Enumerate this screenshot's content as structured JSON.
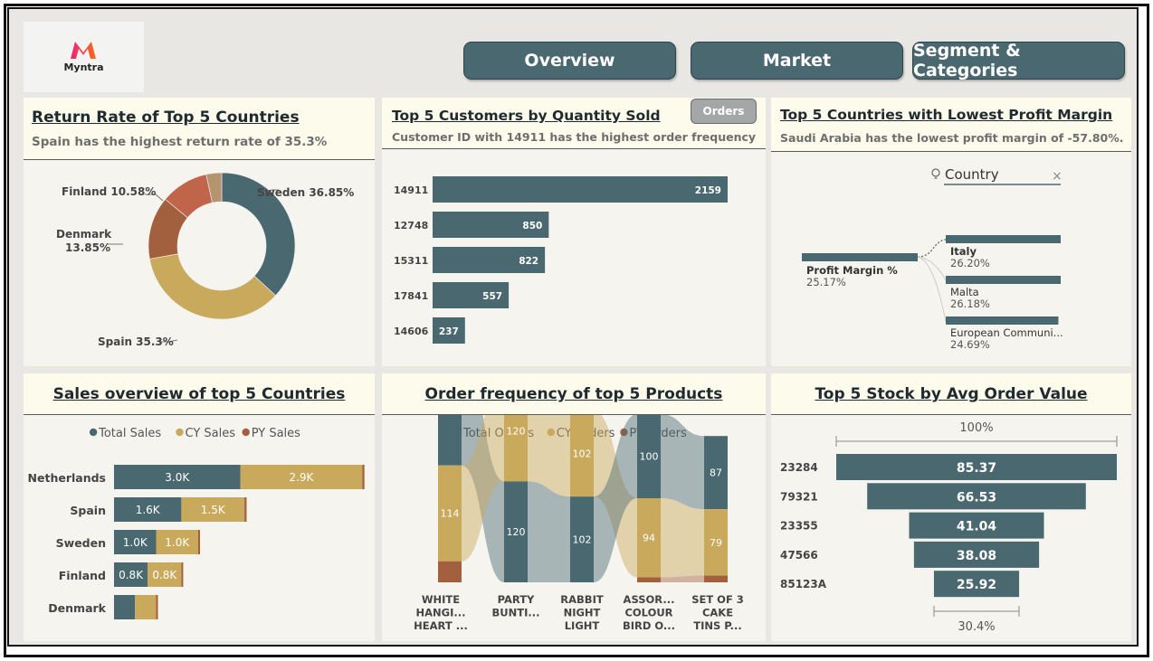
{
  "brand": {
    "name": "Myntra"
  },
  "nav": {
    "overview": "Overview",
    "market": "Market",
    "segment": "Segment & Categories"
  },
  "colors": {
    "slate": "#4a6870",
    "gold": "#c9a95c",
    "rust": "#a3603e",
    "tan": "#b59470",
    "red": "#c0644a",
    "panel": "#f6f4ef",
    "header": "#fdfbec"
  },
  "return_rate": {
    "title": "Return Rate of Top 5 Countries",
    "subtitle": "Spain has the highest return rate  of 35.3%",
    "labels": {
      "sweden": "Sweden 36.85%",
      "spain": "Spain 35.3%",
      "denmark_name": "Denmark",
      "denmark_pct": "13.85%",
      "finland": "Finland 10.58%"
    }
  },
  "customers": {
    "title": "Top 5 Customers by Quantity Sold",
    "subtitle": "Customer ID with 14911 has the highest order frequency",
    "orders_button": "Orders"
  },
  "profit_margin": {
    "title": "Top 5 Countries with Lowest Profit Margin",
    "subtitle": "Saudi Arabia has the lowest profit margin of -57.80%.",
    "search_label": "Country",
    "root_label": "Profit Margin %",
    "root_value": "25.17%",
    "nodes": [
      {
        "name": "Italy",
        "value": "26.20%",
        "fraction": 1.0
      },
      {
        "name": "Malta",
        "value": "26.18%",
        "fraction": 1.0
      },
      {
        "name": "European Communi...",
        "value": "24.69%",
        "fraction": 0.98
      }
    ]
  },
  "sales": {
    "title": "Sales overview of top 5 Countries",
    "legend": [
      "Total Sales",
      "CY Sales",
      "PY Sales"
    ]
  },
  "order_freq": {
    "title": "Order frequency of top 5 Products",
    "legend": [
      "Total Orders",
      "CY Orders",
      "PY Orders"
    ],
    "labels": [
      [
        "WHITE",
        "HANGI...",
        "HEART ..."
      ],
      [
        "PARTY",
        "BUNTI..."
      ],
      [
        "RABBIT",
        "NIGHT",
        "LIGHT"
      ],
      [
        "ASSOR...",
        "COLOUR",
        "BIRD O..."
      ],
      [
        "SET OF 3",
        "CAKE",
        "TINS P..."
      ]
    ]
  },
  "stock": {
    "title": "Top 5 Stock by Avg Order Value",
    "top_pct": "100%",
    "bottom_pct": "30.4%"
  },
  "chart_data": [
    {
      "type": "pie",
      "variant": "donut",
      "categories": [
        "Sweden",
        "Spain",
        "Denmark",
        "Finland",
        "Other"
      ],
      "values": [
        36.85,
        35.3,
        13.85,
        10.58,
        3.42
      ],
      "colors": [
        "#4a6870",
        "#c9a95c",
        "#a3603e",
        "#c0644a",
        "#b59470"
      ]
    },
    {
      "type": "bar",
      "orientation": "horizontal",
      "categories": [
        "14911",
        "12748",
        "15311",
        "17841",
        "14606"
      ],
      "values": [
        2159,
        850,
        822,
        557,
        237
      ],
      "data_labels": [
        "2159",
        "850",
        "822",
        "557",
        "237"
      ]
    },
    {
      "type": "bar",
      "orientation": "horizontal",
      "stacked": true,
      "categories": [
        "Netherlands",
        "Spain",
        "Sweden",
        "Finland",
        "Denmark"
      ],
      "series": [
        {
          "name": "Total Sales",
          "values": [
            3.0,
            1.6,
            1.0,
            0.8,
            0.5
          ],
          "labels": [
            "3.0K",
            "1.6K",
            "1.0K",
            "0.8K",
            ""
          ]
        },
        {
          "name": "CY Sales",
          "values": [
            2.9,
            1.5,
            1.0,
            0.8,
            0.5
          ],
          "labels": [
            "2.9K",
            "1.5K",
            "1.0K",
            "0.8K",
            ""
          ]
        },
        {
          "name": "PY Sales",
          "values": [
            0.05,
            0.05,
            0.02,
            0.01,
            0.01
          ],
          "labels": [
            "",
            "",
            "",
            "",
            ""
          ]
        }
      ],
      "legend": "top-center"
    },
    {
      "type": "bar",
      "variant": "ribbon",
      "stacked": true,
      "categories": [
        "WHITE HANGI... HEART ...",
        "PARTY BUNTI...",
        "RABBIT NIGHT LIGHT",
        "ASSOR... COLOUR BIRD O...",
        "SET OF 3 CAKE TINS P..."
      ],
      "series": [
        {
          "name": "Total Orders",
          "values": [
            139,
            120,
            102,
            100,
            87
          ]
        },
        {
          "name": "CY Orders",
          "values": [
            114,
            120,
            102,
            94,
            79
          ]
        },
        {
          "name": "PY Orders",
          "values": [
            25,
            0,
            0,
            6,
            8
          ]
        }
      ],
      "legend": "top-center"
    },
    {
      "type": "bar",
      "variant": "funnel",
      "categories": [
        "23284",
        "79321",
        "23355",
        "47566",
        "85123A"
      ],
      "values": [
        85.37,
        66.53,
        41.04,
        38.08,
        25.92
      ],
      "data_labels": [
        "85.37",
        "66.53",
        "41.04",
        "38.08",
        "25.92"
      ]
    }
  ]
}
